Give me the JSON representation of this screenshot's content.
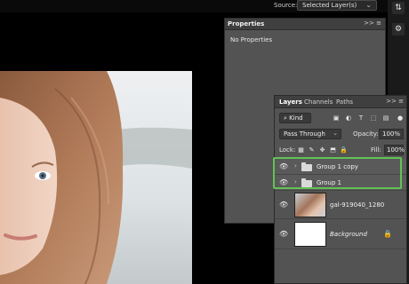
{
  "options_bar": {
    "source_label": "Source:",
    "source_value": "Selected Layer(s)"
  },
  "right_strip": {
    "tool1_icon": "adjust-icon",
    "tool2_icon": "properties-icon"
  },
  "properties_panel": {
    "tab": "Properties",
    "empty_text": "No Properties",
    "collapse_glyph": ">>",
    "menu_glyph": "≡"
  },
  "layers_panel": {
    "tabs": [
      "Layers",
      "Channels",
      "Paths"
    ],
    "collapse_glyph": ">>",
    "menu_glyph": "≡",
    "filter": {
      "label": "Kind"
    },
    "blend_mode": "Pass Through",
    "opacity_label": "Opacity:",
    "opacity_value": "100%",
    "lock_label": "Lock:",
    "fill_label": "Fill:",
    "fill_value": "100%",
    "layers": [
      {
        "name": "Group 1 copy",
        "type": "group"
      },
      {
        "name": "Group 1",
        "type": "group"
      },
      {
        "name": "gal-919040_1280",
        "type": "image"
      },
      {
        "name": "Background",
        "type": "background"
      }
    ]
  },
  "colors": {
    "highlight": "#62c256",
    "panel_bg": "#535353",
    "canvas_bg": "#000000"
  }
}
